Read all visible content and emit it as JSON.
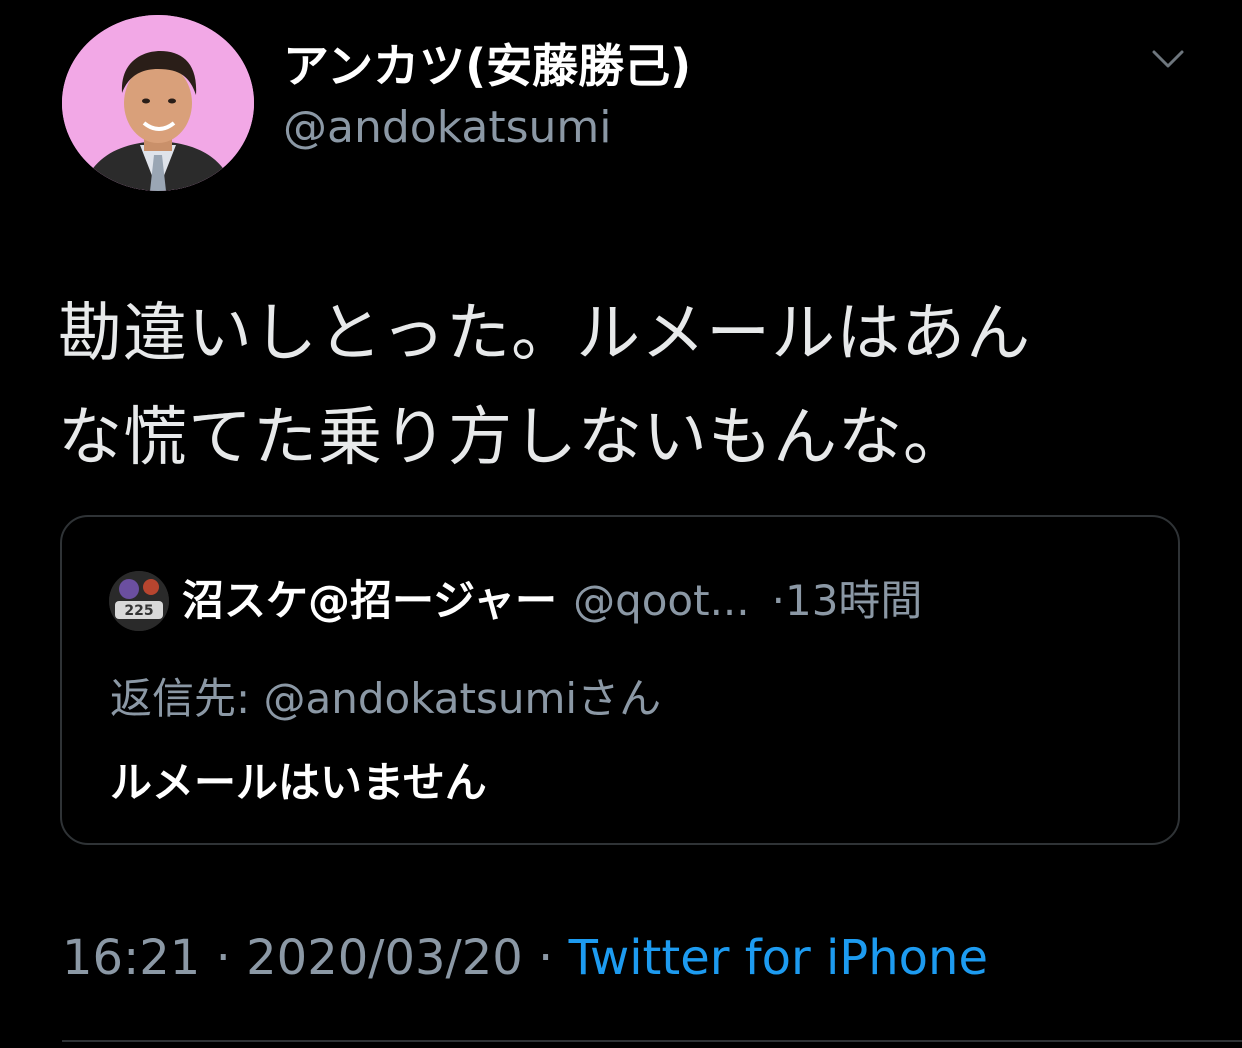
{
  "author": {
    "display_name": "アンカツ(安藤勝己)",
    "handle": "@andokatsumi",
    "avatar_icon": "profile-photo"
  },
  "menu": {
    "icon": "chevron-down-icon"
  },
  "tweet": {
    "lines": [
      "勘違いしとった。ルメールはあん",
      "な慌てた乗り方しないもんな。"
    ]
  },
  "quoted_tweet": {
    "avatar_icon": "profile-photo",
    "display_name": "沼スケ@招ージャー",
    "handle": "@qoot...",
    "time": "·13時間",
    "reply_to": "返信先: @andokatsumiさん",
    "text": "ルメールはいません"
  },
  "meta": {
    "time": "16:21",
    "separator": "·",
    "date": "2020/03/20",
    "source": "Twitter for iPhone"
  },
  "colors": {
    "background": "#000000",
    "secondary_text": "#8b98a5",
    "link": "#1d9bf0",
    "border": "#2f3336"
  }
}
